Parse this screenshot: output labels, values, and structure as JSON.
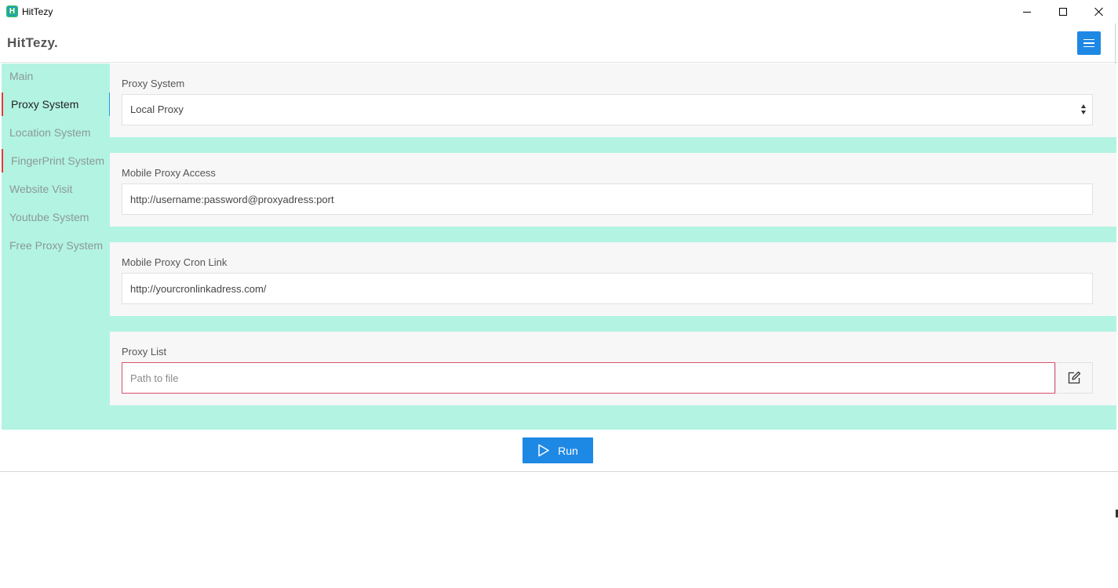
{
  "window": {
    "title": "HitTezy",
    "icon_letter": "H"
  },
  "header": {
    "brand": "HitTezy."
  },
  "sidebar": {
    "items": [
      {
        "label": "Main"
      },
      {
        "label": "Proxy System"
      },
      {
        "label": "Location System"
      },
      {
        "label": "FingerPrint System"
      },
      {
        "label": "Website Visit"
      },
      {
        "label": "Youtube System"
      },
      {
        "label": "Free Proxy System"
      }
    ],
    "active": "Proxy System"
  },
  "form": {
    "proxy_system": {
      "label": "Proxy System",
      "value": "Local Proxy"
    },
    "mobile_proxy_access": {
      "label": "Mobile Proxy Access",
      "value": "http://username:password@proxyadress:port"
    },
    "mobile_proxy_cron_link": {
      "label": "Mobile Proxy Cron Link",
      "value": "http://yourcronlinkadress.com/"
    },
    "proxy_list": {
      "label": "Proxy List",
      "value": "",
      "placeholder": "Path to file"
    }
  },
  "footer": {
    "run_label": "Run"
  },
  "colors": {
    "accent": "#1e88e5",
    "sidebar_bg": "#b3f3e2",
    "section_bg": "#f7f7f7",
    "active_marker": "#e53935",
    "error_border": "#d9506c"
  },
  "icons": {
    "menu": "hamburger-icon",
    "edit": "edit-icon",
    "run": "play-icon"
  }
}
